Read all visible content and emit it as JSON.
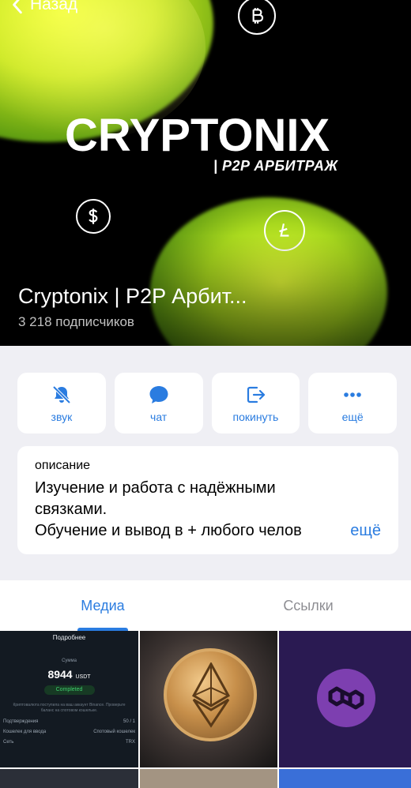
{
  "header": {
    "back_label": "Назад"
  },
  "hero": {
    "logo_title": "CRYPTONIX",
    "logo_subtitle": "| P2P АРБИТРАЖ",
    "channel_name": "Cryptonix | P2P Арбит...",
    "subscribers": "3 218 подписчиков",
    "icons": [
      "bitcoin-icon",
      "dollar-icon",
      "litecoin-icon"
    ]
  },
  "actions": [
    {
      "label": "звук",
      "icon": "bell-slash-icon"
    },
    {
      "label": "чат",
      "icon": "chat-bubble-icon"
    },
    {
      "label": "покинуть",
      "icon": "leave-icon"
    },
    {
      "label": "ещё",
      "icon": "more-dots-icon"
    }
  ],
  "description": {
    "label": "описание",
    "line1": "Изучение и работа с надёжными",
    "line2": "связками.",
    "line3": "Обучение и вывод в + любого челов",
    "more": "ещё"
  },
  "tabs": [
    {
      "label": "Медиа",
      "active": true
    },
    {
      "label": "Ссылки",
      "active": false
    }
  ],
  "media": {
    "receipt": {
      "title": "Подробнее",
      "amount_label": "Сумма",
      "amount": "8944",
      "currency": "USDT",
      "status": "Completed",
      "note": "Криптовалюта поступила на ваш аккаунт Binance. Проверьте баланс на спотовом кошельке.",
      "rows": [
        {
          "k": "Подтверждения",
          "v": "50 / 1"
        },
        {
          "k": "Кошелек для ввода",
          "v": "Спотовый кошелек"
        },
        {
          "k": "Сеть",
          "v": "TRX"
        }
      ]
    }
  },
  "colors": {
    "accent": "#2a7ce0",
    "background": "#efeff4",
    "hero_green": "#c8e61e"
  }
}
